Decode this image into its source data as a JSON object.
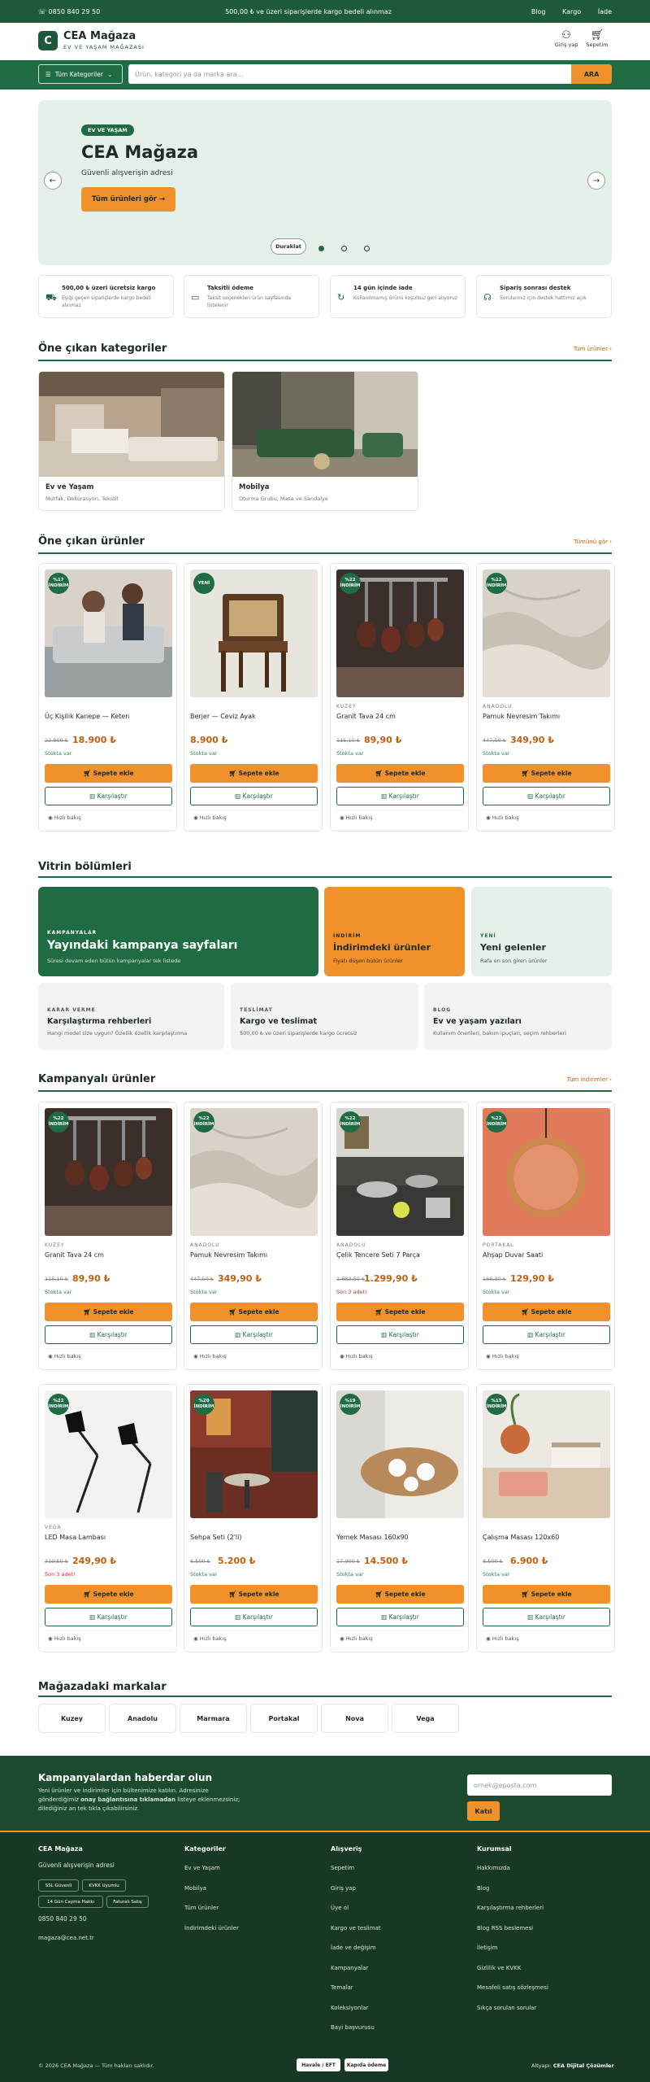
{
  "topbar": {
    "phone": "0850 840 29 50",
    "announcement": "500,00 ₺ ve üzeri siparişlerde kargo bedeli alınmaz",
    "links": [
      "Blog",
      "Kargo",
      "İade"
    ]
  },
  "header": {
    "logo_letter": "C",
    "brand": "CEA Mağaza",
    "tagline": "EV VE YAŞAM MAĞAZASI",
    "login": "Giriş yap",
    "cart": "Sepetim"
  },
  "nav": {
    "categories": "Tüm Kategoriler",
    "search_placeholder": "Ürün, kategori ya da marka ara...",
    "search_button": "ARA"
  },
  "hero": {
    "badge": "EV VE YAŞAM",
    "title": "CEA Mağaza",
    "subtitle": "Güvenli alışverişin adresi",
    "cta": "Tüm ürünleri gör →",
    "pause": "Duraklat"
  },
  "features": [
    {
      "title": "500,00 ₺ üzeri ücretsiz kargo",
      "desc": "Eşiği geçen siparişlerde kargo bedeli alınmaz"
    },
    {
      "title": "Taksitli ödeme",
      "desc": "Taksit seçenekleri ürün sayfasında listelenir"
    },
    {
      "title": "14 gün içinde iade",
      "desc": "Kullanılmamış ürünü koşulsuz geri alıyoruz"
    },
    {
      "title": "Sipariş sonrası destek",
      "desc": "Sorularınız için destek hattımız açık"
    }
  ],
  "featured_categories": {
    "title": "Öne çıkan kategoriler",
    "link": "Tüm ürünler ›",
    "items": [
      {
        "name": "Ev ve Yaşam",
        "desc": "Mutfak, Dekorasyon, Tekstil"
      },
      {
        "name": "Mobilya",
        "desc": "Oturma Grubu, Masa ve Sandalye"
      }
    ]
  },
  "featured_products": {
    "title": "Öne çıkan ürünler",
    "link": "Tümünü gör ›",
    "items": [
      {
        "badge1": "%17",
        "badge2": "İNDİRİM",
        "brand": "",
        "name": "Üç Kişilik Kanepe — Keten",
        "old": "22.900 ₺",
        "price": "18.900 ₺",
        "stock": "Stokta var"
      },
      {
        "badge1": "YENİ",
        "badge2": "",
        "brand": "",
        "name": "Berjer — Ceviz Ayak",
        "old": "",
        "price": "8.900 ₺",
        "stock": "Stokta var"
      },
      {
        "badge1": "%22",
        "badge2": "İNDİRİM",
        "brand": "KUZEY",
        "name": "Granit Tava 24 cm",
        "old": "115,10 ₺",
        "price": "89,90 ₺",
        "stock": "Stokta var"
      },
      {
        "badge1": "%22",
        "badge2": "İNDİRİM",
        "brand": "ANADOLU",
        "name": "Pamuk Nevresim Takımı",
        "old": "447,50 ₺",
        "price": "349,90 ₺",
        "stock": "Stokta var"
      }
    ]
  },
  "buttons": {
    "add": "Sepete ekle",
    "compare": "Karşılaştır",
    "quick": "Hızlı bakış"
  },
  "showcase": {
    "title": "Vitrin bölümleri",
    "cards": [
      {
        "kicker": "KAMPANYALAR",
        "title": "Yayındaki kampanya sayfaları",
        "desc": "Süresi devam eden bütün kampanyalar tek listede"
      },
      {
        "kicker": "İNDİRİM",
        "title": "İndirimdeki ürünler",
        "desc": "Fiyatı düşen bütün ürünler"
      },
      {
        "kicker": "YENİ",
        "title": "Yeni gelenler",
        "desc": "Rafa en son giren ürünler"
      },
      {
        "kicker": "KARAR VERME",
        "title": "Karşılaştırma rehberleri",
        "desc": "Hangi model size uygun? Özellik özellik karşılaştırma"
      },
      {
        "kicker": "TESLİMAT",
        "title": "Kargo ve teslimat",
        "desc": "500,00 ₺ ve üzeri siparişlerde kargo ücretsiz"
      },
      {
        "kicker": "BLOG",
        "title": "Ev ve yaşam yazıları",
        "desc": "Kullanım önerileri, bakım ipuçları, seçim rehberleri"
      }
    ]
  },
  "campaign": {
    "title": "Kampanyalı ürünler",
    "link": "Tüm indirimler ›",
    "items": [
      {
        "badge1": "%22",
        "badge2": "İNDİRİM",
        "brand": "KUZEY",
        "name": "Granit Tava 24 cm",
        "old": "115,10 ₺",
        "price": "89,90 ₺",
        "stock": "Stokta var",
        "low": false
      },
      {
        "badge1": "%22",
        "badge2": "İNDİRİM",
        "brand": "ANADOLU",
        "name": "Pamuk Nevresim Takımı",
        "old": "447,50 ₺",
        "price": "349,90 ₺",
        "stock": "Stokta var",
        "low": false
      },
      {
        "badge1": "%22",
        "badge2": "İNDİRİM",
        "brand": "ANADOLU",
        "name": "Çelik Tencere Seti 7 Parça",
        "old": "1.683,50 ₺",
        "price": "1.299,90 ₺",
        "stock": "Son 3 adet!",
        "low": true
      },
      {
        "badge1": "%22",
        "badge2": "İNDİRİM",
        "brand": "PORTAKAL",
        "name": "Ahşap Duvar Saati",
        "old": "166,30 ₺",
        "price": "129,90 ₺",
        "stock": "Stokta var",
        "low": false
      },
      {
        "badge1": "%22",
        "badge2": "İNDİRİM",
        "brand": "VEGA",
        "name": "LED Masa Lambası",
        "old": "319,50 ₺",
        "price": "249,90 ₺",
        "stock": "Son 3 adet!",
        "low": true
      },
      {
        "badge1": "%20",
        "badge2": "İNDİRİM",
        "brand": "",
        "name": "Sehpa Seti (2'li)",
        "old": "6.500 ₺",
        "price": "5.200 ₺",
        "stock": "Stokta var",
        "low": false
      },
      {
        "badge1": "%19",
        "badge2": "İNDİRİM",
        "brand": "",
        "name": "Yemek Masası 160x90",
        "old": "17.900 ₺",
        "price": "14.500 ₺",
        "stock": "Stokta var",
        "low": false
      },
      {
        "badge1": "%19",
        "badge2": "İNDİRİM",
        "brand": "",
        "name": "Çalışma Masası 120x60",
        "old": "8.500 ₺",
        "price": "6.900 ₺",
        "stock": "Stokta var",
        "low": false
      }
    ]
  },
  "brands": {
    "title": "Mağazadaki markalar",
    "items": [
      "Kuzey",
      "Anadolu",
      "Marmara",
      "Portakal",
      "Nova",
      "Vega"
    ]
  },
  "newsletter": {
    "title": "Kampanyalardan haberdar olun",
    "text_a": "Yeni ürünler ve indirimler için bültenimize katılın. Adresinize gönderdiğimiz ",
    "text_b": "onay bağlantısına tıklamadan",
    "text_c": " listeye eklenmezsiniz; dilediğiniz an tek tıkla çıkabilirsiniz.",
    "placeholder": "ornek@eposta.com",
    "button": "Katıl"
  },
  "footer": {
    "store": {
      "title": "CEA Mağaza",
      "tagline": "Güvenli alışverişin adresi",
      "tags": [
        "SSL Güvenli",
        "KVKK Uyumlu",
        "14 Gün Cayma Hakkı",
        "Faturalı Satış"
      ],
      "phone": "0850 840 29 50",
      "email": "magaza@cea.net.tr"
    },
    "categories": {
      "title": "Kategoriler",
      "links": [
        "Ev ve Yaşam",
        "Mobilya",
        "Tüm ürünler",
        "İndirimdeki ürünler"
      ]
    },
    "shopping": {
      "title": "Alışveriş",
      "links": [
        "Sepetim",
        "Giriş yap",
        "Üye ol",
        "Kargo ve teslimat",
        "İade ve değişim",
        "Kampanyalar",
        "Temalar",
        "Koleksiyonlar",
        "Bayi başvurusu"
      ]
    },
    "corporate": {
      "title": "Kurumsal",
      "links": [
        "Hakkımızda",
        "Blog",
        "Karşılaştırma rehberleri",
        "Blog RSS beslemesi",
        "İletişim",
        "Gizlilik ve KVKK",
        "Mesafeli satış sözleşmesi",
        "Sıkça sorulan sorular"
      ]
    },
    "copyright": "© 2026 CEA Mağaza — Tüm hakları saklıdır.",
    "payments": [
      "Havale / EFT",
      "Kapıda ödeme"
    ],
    "infra_a": "Altyapı: ",
    "infra_b": "CEA Dijital Çözümler"
  },
  "colors": {
    "primary": "#1f6b44",
    "dark": "#1c5a3a",
    "accent": "#f0912b",
    "price": "#c05f0e",
    "hero_bg": "#e4f1e8"
  }
}
